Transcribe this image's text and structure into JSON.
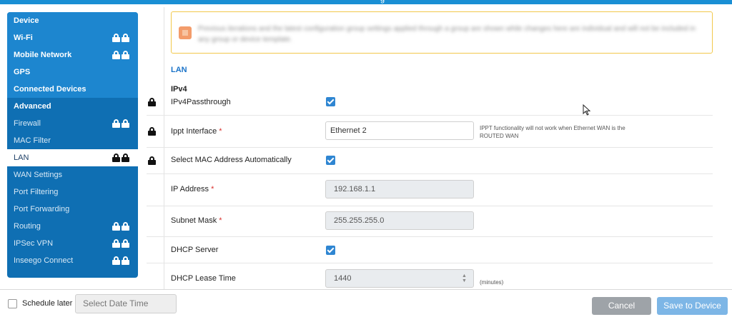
{
  "window": {
    "title_fragment": "g"
  },
  "colors": {
    "accent": "#1a8fd4",
    "sidebar_bg": "#0f6fb3",
    "sidebar_top_bg": "#1d86cf",
    "required": "#d9302c",
    "notice_border": "#f2c84b"
  },
  "sidebar": {
    "items": [
      {
        "label": "Device",
        "locked": false
      },
      {
        "label": "Wi-Fi",
        "locked": true
      },
      {
        "label": "Mobile Network",
        "locked": true
      },
      {
        "label": "GPS",
        "locked": false
      },
      {
        "label": "Connected Devices",
        "locked": false
      },
      {
        "label": "Advanced",
        "locked": false
      },
      {
        "label": "Firewall",
        "locked": true
      },
      {
        "label": "MAC Filter",
        "locked": false
      },
      {
        "label": "LAN",
        "locked": true,
        "active": true
      },
      {
        "label": "WAN Settings",
        "locked": false
      },
      {
        "label": "Port Filtering",
        "locked": false
      },
      {
        "label": "Port Forwarding",
        "locked": false
      },
      {
        "label": "Routing",
        "locked": true
      },
      {
        "label": "IPSec VPN",
        "locked": true
      },
      {
        "label": "Inseego Connect",
        "locked": true
      }
    ]
  },
  "notice": {
    "icon": "warning-icon",
    "text": "Previous iterations and the latest configuration group settings applied through a group are shown while changes here are individual and will not be included in any group or device template."
  },
  "main": {
    "section_title": "LAN",
    "subsection_title": "IPv4",
    "fields": {
      "ipv4_passthrough": {
        "label": "IPv4Passthrough",
        "checked": true
      },
      "ippt_interface": {
        "label": "Ippt Interface",
        "required_mark": "*",
        "value": "Ethernet 2",
        "hint": "IPPT functionality will not work when Ethernet WAN is the ROUTED WAN"
      },
      "select_mac_auto": {
        "label": "Select MAC Address Automatically",
        "checked": true
      },
      "ip_address": {
        "label": "IP Address",
        "required_mark": "*",
        "value": "192.168.1.1"
      },
      "subnet_mask": {
        "label": "Subnet Mask",
        "required_mark": "*",
        "value": "255.255.255.0"
      },
      "dhcp_server": {
        "label": "DHCP Server",
        "checked": true
      },
      "dhcp_lease_time": {
        "label": "DHCP Lease Time",
        "value": "1440",
        "unit": "(minutes)"
      }
    }
  },
  "footer": {
    "schedule_label": "Schedule later",
    "date_placeholder": "Select Date Time",
    "cancel_label": "Cancel",
    "save_label": "Save to Device"
  }
}
